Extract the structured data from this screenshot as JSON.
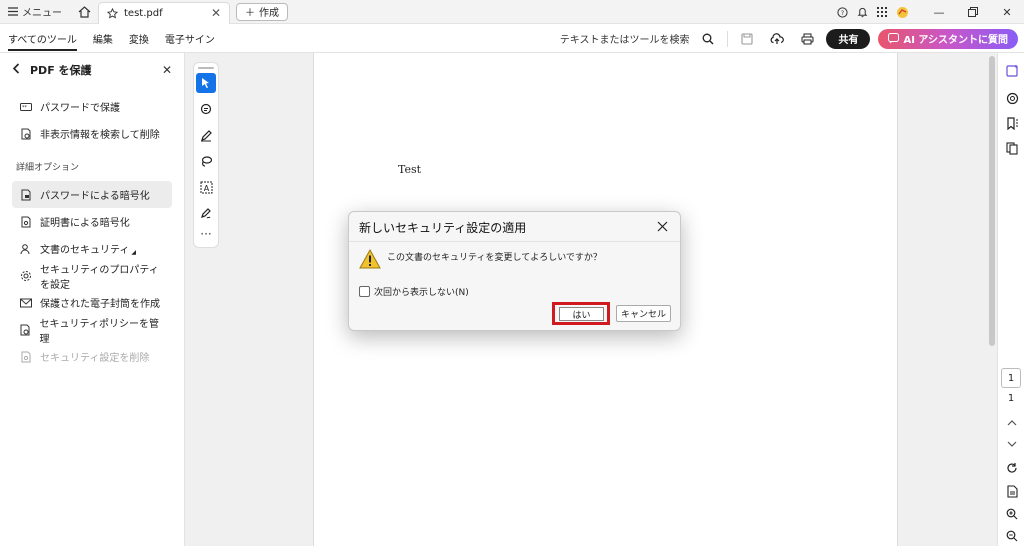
{
  "titlebar": {
    "menu_label": "メニュー",
    "tab_title": "test.pdf",
    "new_label": "作成"
  },
  "toolbar": {
    "tabs": [
      {
        "label": "すべてのツール",
        "active": true
      },
      {
        "label": "編集"
      },
      {
        "label": "変換"
      },
      {
        "label": "電子サイン"
      }
    ],
    "search_label": "テキストまたはツールを検索",
    "share_label": "共有",
    "ai_label": "AI アシスタントに質問"
  },
  "left_panel": {
    "title": "PDF を保護",
    "items": [
      {
        "label": "パスワードで保護",
        "icon": "password-icon"
      },
      {
        "label": "非表示情報を検索して削除",
        "icon": "redact-search-icon"
      }
    ],
    "section_label": "詳細オプション",
    "advanced_items": [
      {
        "label": "パスワードによる暗号化",
        "icon": "lock-file-icon",
        "selected": true
      },
      {
        "label": "証明書による暗号化",
        "icon": "certificate-icon"
      },
      {
        "label": "文書のセキュリティ",
        "icon": "user-security-icon"
      },
      {
        "label": "セキュリティのプロパティを設定",
        "icon": "gear-security-icon"
      },
      {
        "label": "保護された電子封筒を作成",
        "icon": "envelope-icon"
      },
      {
        "label": "セキュリティポリシーを管理",
        "icon": "policy-icon"
      },
      {
        "label": "セキュリティ設定を削除",
        "icon": "remove-security-icon",
        "disabled": true
      }
    ]
  },
  "document": {
    "page_text": "Test",
    "current_page": "1",
    "total_pages": "1"
  },
  "dialog": {
    "title": "新しいセキュリティ設定の適用",
    "message": "この文書のセキュリティを変更してよろしいですか？",
    "checkbox_label": "次回から表示しない(N)",
    "yes_label": "はい",
    "cancel_label": "キャンセル"
  },
  "colors": {
    "accent_blue": "#1473e6",
    "highlight_red": "#d11a1f",
    "share_bg": "#1c1c1c"
  }
}
